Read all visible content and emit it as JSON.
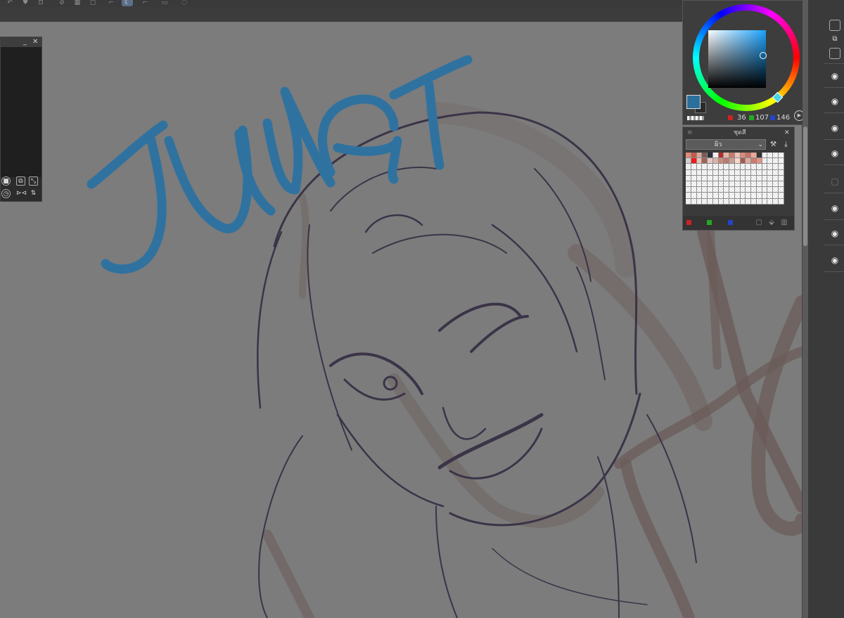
{
  "app": {
    "accent": "#5c6f88",
    "canvas_bg": "#7c7c7c",
    "lettering_color": "#2f72a0",
    "sketch_color": "#3b3448",
    "rough_color": "#6a5a57"
  },
  "toolbar": {
    "icons": [
      "undo-icon",
      "redo-icon",
      "transform-icon",
      "crop-icon",
      "grid-icon",
      "ruler-icon",
      "snap-icon",
      "lasso-icon",
      "select-icon",
      "fill-icon",
      "settings-icon",
      "comment-icon"
    ]
  },
  "navigator": {
    "minimize": "_",
    "close": "✕",
    "controls": [
      "fit-icon",
      "zoom-icon",
      "resize-icon",
      "rotate-icon",
      "flip-horizontal-icon",
      "flip-vertical-icon"
    ]
  },
  "color_panel": {
    "red": "36",
    "green": "107",
    "blue": "146",
    "main_color": "#246b92",
    "rgb_colors": {
      "r": "#cc2222",
      "g": "#22aa22",
      "b": "#2244cc"
    }
  },
  "palette": {
    "title": "ชุดสี",
    "selected_set": "ผิว",
    "minimize": "≡",
    "close": "✕",
    "swatch_row1": [
      "#e28a78",
      "#c45a4b",
      "#d9a89a",
      "#7d5a52",
      "#2b2f3d",
      "#eeeeee",
      "#b62b2b",
      "#e0b4a8",
      "#c97a6b",
      "#eec3b8",
      "#d88d7c",
      "#c77060",
      "#e8a898",
      "#333333"
    ],
    "swatch_row2": [
      "#d0d0d0",
      "#ec1c1c",
      "#efc2b6",
      "#9e6455",
      "#e0c9c4",
      "#d9b3a9",
      "#c98b7e",
      "#b97b6f",
      "#c99c94",
      "#f4d8d0",
      "#a85950",
      "#d8aca0",
      "#cc7b6e",
      "#e68f85"
    ]
  },
  "layers": {
    "visibility_icons": 8
  }
}
